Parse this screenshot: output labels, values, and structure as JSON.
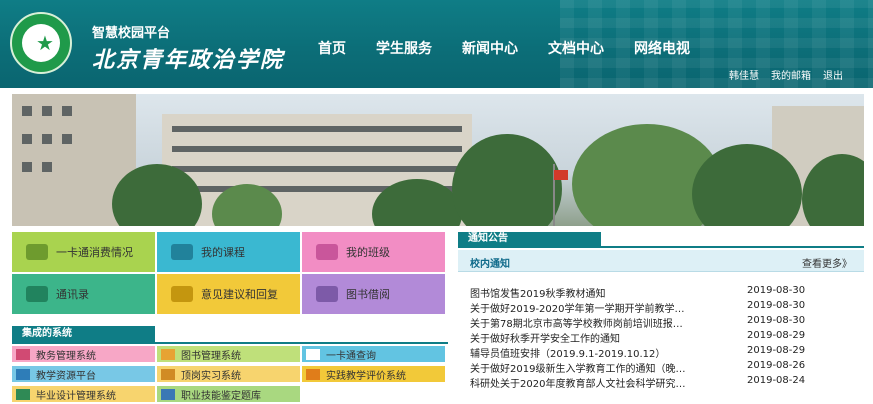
{
  "header": {
    "platform": "智慧校园平台",
    "school_name": "北京青年政治学院",
    "nav": [
      "首页",
      "学生服务",
      "新闻中心",
      "文档中心",
      "网络电视"
    ],
    "user_links": [
      "韩佳慧",
      "我的邮箱",
      "退出"
    ]
  },
  "tiles": [
    {
      "label": "一卡通消费情况",
      "color": "#a9d34f",
      "icon": "card-icon"
    },
    {
      "label": "我的课程",
      "color": "#3ab8d1",
      "icon": "monitor-icon"
    },
    {
      "label": "我的班级",
      "color": "#f28dc4",
      "icon": "class-icon"
    },
    {
      "label": "通讯录",
      "color": "#3cb58a",
      "icon": "contacts-icon"
    },
    {
      "label": "意见建议和回复",
      "color": "#f2c939",
      "icon": "mail-icon"
    },
    {
      "label": "图书借阅",
      "color": "#b28ad8",
      "icon": "book-icon"
    }
  ],
  "systems": {
    "heading": "集成的系统",
    "items": [
      {
        "label": "教务管理系统",
        "icon": "keyboard-icon"
      },
      {
        "label": "图书管理系统",
        "icon": "books-icon"
      },
      {
        "label": "一卡通查询",
        "icon": "card-icon"
      },
      {
        "label": "教学资源平台",
        "icon": "screen-icon"
      },
      {
        "label": "顶岗实习系统",
        "icon": "search-icon"
      },
      {
        "label": "实践教学评价系统",
        "icon": "tools-icon"
      },
      {
        "label": "毕业设计管理系统",
        "icon": "document-icon"
      },
      {
        "label": "职业技能鉴定题库",
        "icon": "database-icon"
      }
    ]
  },
  "notices": {
    "heading": "通知公告",
    "tab": "校内通知",
    "more": "查看更多》",
    "items": [
      {
        "title": "图书馆发售2019秋季教材通知",
        "date": "2019-08-30"
      },
      {
        "title": "关于做好2019-2020学年第一学期开学前教学…",
        "date": "2019-08-30"
      },
      {
        "title": "关于第78期北京市高等学校教师岗前培训班报…",
        "date": "2019-08-30"
      },
      {
        "title": "关于做好秋季开学安全工作的通知",
        "date": "2019-08-29"
      },
      {
        "title": "辅导员值班安排（2019.9.1-2019.10.12）",
        "date": "2019-08-29"
      },
      {
        "title": "关于做好2019级新生入学教育工作的通知（晚…",
        "date": "2019-08-26"
      },
      {
        "title": "科研处关于2020年度教育部人文社会科学研究…",
        "date": "2019-08-24"
      }
    ]
  },
  "colors": {
    "brand": "#0f7d86"
  }
}
